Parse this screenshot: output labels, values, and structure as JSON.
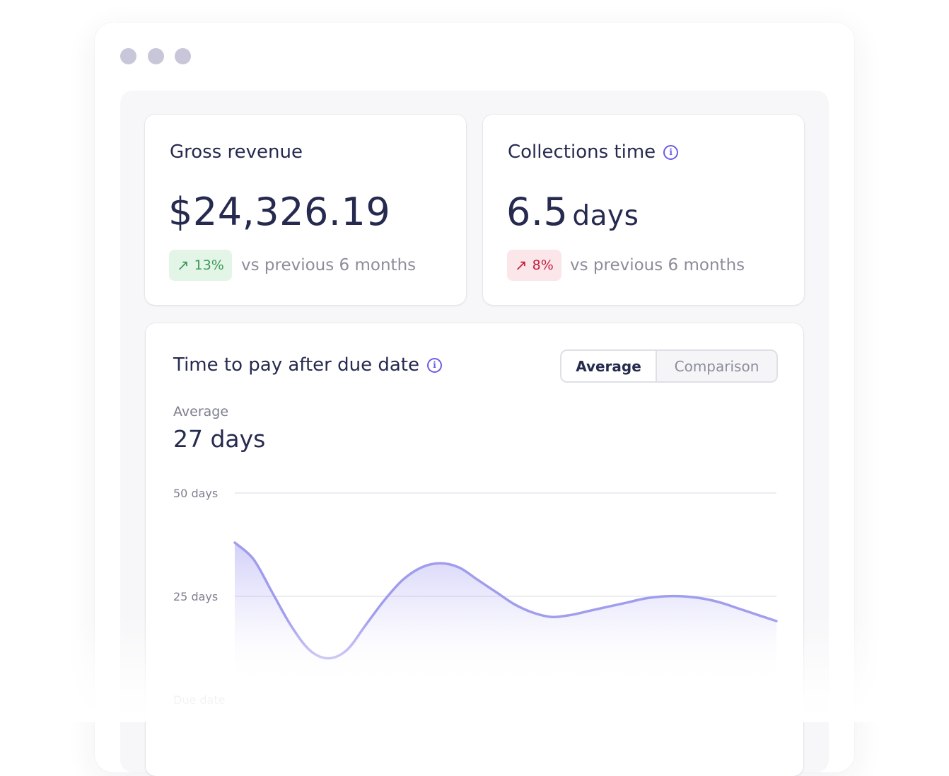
{
  "window": {
    "dot_colors": [
      "#c8c6d9",
      "#c8c6d9",
      "#c8c6d9"
    ]
  },
  "colors": {
    "accent": "#6b5ce7",
    "positive": "#3f9a58",
    "negative": "#c4203f",
    "chart_line": "#a19ded"
  },
  "gross_revenue": {
    "title": "Gross revenue",
    "value": "$24,326.19",
    "change": "13%",
    "change_direction": "up",
    "comparison": "vs previous 6 months"
  },
  "collections_time": {
    "title": "Collections time",
    "value": "6.5",
    "unit": "days",
    "change": "8%",
    "change_direction": "up",
    "comparison": "vs previous 6 months"
  },
  "time_to_pay": {
    "title": "Time to pay after due date",
    "toggle": {
      "options": [
        "Average",
        "Comparison"
      ],
      "selected": "Average"
    },
    "average_label": "Average",
    "average_value": "27 days"
  },
  "chart_data": {
    "type": "area",
    "y_ticks": [
      "50 days",
      "25 days",
      "Due date"
    ],
    "ylim": [
      0,
      50
    ],
    "y": [
      38,
      34,
      26,
      18,
      12,
      10,
      12,
      18,
      24,
      29,
      32,
      33,
      32,
      29,
      26,
      23,
      21,
      20,
      20.5,
      21.5,
      22.5,
      23.5,
      24.5,
      25,
      25,
      24.5,
      23.5,
      22,
      20.5,
      19
    ],
    "grid": true,
    "legend": "none"
  }
}
